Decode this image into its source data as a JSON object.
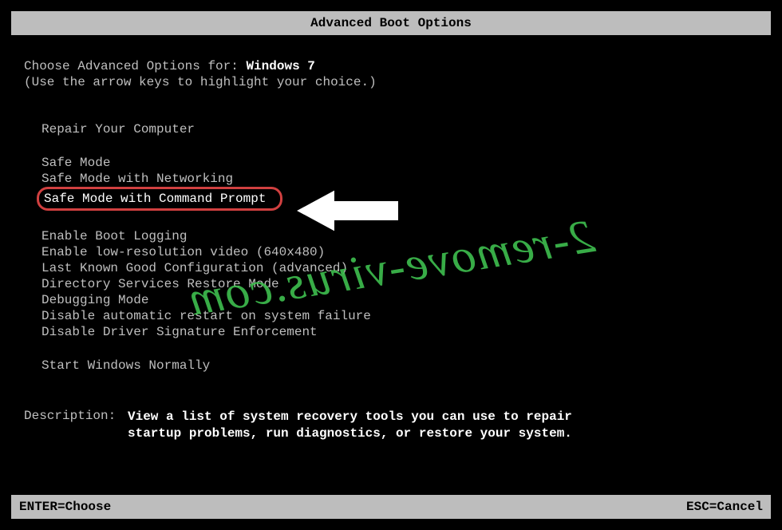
{
  "title": "Advanced Boot Options",
  "prompt": {
    "prefix": "Choose Advanced Options for: ",
    "os": "Windows 7",
    "hint": "(Use the arrow keys to highlight your choice.)"
  },
  "menu": {
    "group1": {
      "repair": "Repair Your Computer"
    },
    "group2": {
      "safeMode": "Safe Mode",
      "safeModeNet": "Safe Mode with Networking",
      "safeModeCmd": "Safe Mode with Command Prompt"
    },
    "group3": {
      "bootLog": "Enable Boot Logging",
      "lowRes": "Enable low-resolution video (640x480)",
      "lastGood": "Last Known Good Configuration (advanced)",
      "dsRestore": "Directory Services Restore Mode",
      "debug": "Debugging Mode",
      "noAutoRestart": "Disable automatic restart on system failure",
      "noDriverSig": "Disable Driver Signature Enforcement"
    },
    "group4": {
      "startNormal": "Start Windows Normally"
    }
  },
  "description": {
    "label": "Description:",
    "text": "View a list of system recovery tools you can use to repair startup problems, run diagnostics, or restore your system."
  },
  "footer": {
    "enter": "ENTER=Choose",
    "esc": "ESC=Cancel"
  },
  "watermark": "2-remove-virus.com"
}
